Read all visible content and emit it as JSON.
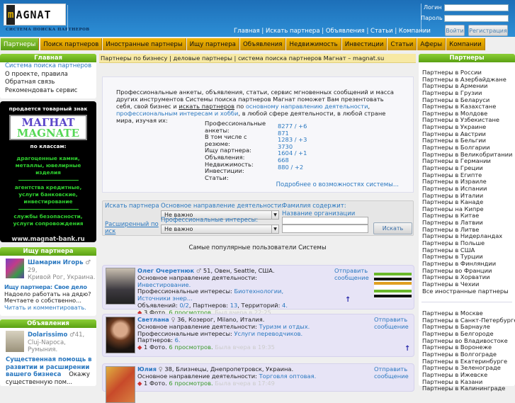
{
  "header": {
    "logo_m": "m",
    "logo_text": "AGNAT",
    "logo_subtitle": "СИСТЕМА ПОИСКА ПАРТНЕРОВ",
    "links": [
      "Главная",
      "Искать партнера",
      "Объявления",
      "Статьи",
      "Компании"
    ],
    "login_label": "Логин",
    "password_label": "Пароль",
    "login_button": "Войти",
    "register_button": "Регистрация"
  },
  "nav": [
    "Партнеры",
    "Поиск партнеров",
    "Иностранные партнеры",
    "Ищу партнера",
    "Объявления",
    "Недвижимость",
    "Инвестиции",
    "Статьи",
    "Аферы",
    "Компании"
  ],
  "left": {
    "main_title": "Главная",
    "main_items": [
      "Система поиска партнеров",
      "О проекте, правила",
      "Обратная связь",
      "Рекомендовать сервис"
    ],
    "banner": {
      "title": "продается товарный знак",
      "tm_line1": "MAГHAT",
      "tm_line2": "MAGNATE",
      "classes": "по классам:",
      "c1": "драгоценные камни, металлы, ювелирные изделия",
      "c2": "агентства кредитные, услуги банковские, инвестирование",
      "c3": "службы безопасности, услуги сопровождения",
      "url": "www.magnat-bank.ru"
    },
    "seek": {
      "title": "Ищу партнера",
      "user": "Шамарин Игорь",
      "age": "29,",
      "city": "Кривой Рог, Украина.",
      "post_title": "Ищу партнера: Свое дело",
      "post_text": "Надоело работать на дядю? Мечтаете о собственно...",
      "read": "Читать и комментировать."
    },
    "ads": {
      "title": "Объявления",
      "user": "Dolarissimo",
      "age": "41,",
      "city": "Cluj-Napoca, Румыния.",
      "post_title": "Существенная помощь в развитии и расширении вашего бизнеса",
      "post_text": "Окажу существенную пом..."
    }
  },
  "center": {
    "breadcrumb": "Партнеры по бизнесу | деловые партнеры | система поиска партнеров Магнат – magnat.su",
    "intro_1": "Профессиональные анкеты, объявления, статьи, сервис мгновенных сообщений и масса других инструментов Системы поиска партнеров Магнат поможет Вам презентовать себя, свой бизнес и ",
    "intro_link1": "искать партнеров",
    "intro_2": " по ",
    "intro_link2": "основному направлению деятельности",
    "intro_3": ", ",
    "intro_link3": "профессиональным интересам и хобби",
    "intro_4": ", в любой сфере деятельности, в любой стране мира, изучая их:",
    "stats": [
      {
        "label": "Профессиональные анкеты:",
        "value": "8277 / +6"
      },
      {
        "label": "В том числе с резюме:",
        "value": "871"
      },
      {
        "label": "Ищу партнера:",
        "value": "1283 / +3"
      },
      {
        "label": "Объявления:",
        "value": "3730"
      },
      {
        "label": "Недвижимость:",
        "value": "1604 / +1"
      },
      {
        "label": "Инвестиции:",
        "value": "668"
      },
      {
        "label": "Статьи:",
        "value": "880 / +2"
      }
    ],
    "more": "Подробнее о возможностях системы...",
    "search": {
      "title": "Искать партнера",
      "advanced": "Расширенный поиск",
      "activity_label": "Основное направление деятельности:",
      "activity_value": "Не важно",
      "interests_label": "Профессиональные интересы:",
      "interests_value": "Не важно",
      "surname_label": "Фамилия содержит:",
      "org_label": "Название организации содержит:",
      "button": "Искать"
    },
    "popular_title": "Самые популярные пользователи Системы",
    "users": [
      {
        "name": "Олег Очеретнюк",
        "info": "51, Овен, Seattle, США.",
        "activity_label": "Основное направление деятельности: ",
        "activity": "Инвестирование.",
        "interests_label": "Профессиональные интересы: ",
        "interests": "Биотехнологии, Источники энер...",
        "counts_a": "Объявлений: ",
        "ads": "0/2",
        "counts_b": ", Партнеров: ",
        "partners": "13",
        "counts_c": ", Территорий: ",
        "territories": "4.",
        "photos": "3 Фото.",
        "views": "6 просмотров.",
        "seen": "Был вчера в 22:25",
        "send": "Отправить сообщение"
      },
      {
        "name": "Светлана",
        "info": "36, Козерог, Milano, Италия.",
        "activity_label": "Основное направление деятельности: ",
        "activity": "Туризм и отдых.",
        "interests_label": "Профессиональные интересы: ",
        "interests": "Услуги переводчиков.",
        "partners_label": "Партнеров: ",
        "partners": "6.",
        "photos": "1 Фото.",
        "views": "6 просмотров.",
        "seen": "Была вчера в 19:35",
        "send": "Отправить сообщение"
      },
      {
        "name": "Юлия",
        "info": "38, Близнецы, Днепропетровск, Украина.",
        "activity_label": "Основное направление деятельности: ",
        "activity": "Торговля оптовая.",
        "photos": "1 Фото.",
        "views": "6 просмотров.",
        "seen": "Была вчера в 17:49",
        "send": "Отправить сообщение"
      }
    ]
  },
  "right": {
    "title": "Партнеры",
    "countries": [
      "Партнеры в России",
      "Партнеры в Азербайджане",
      "Партнеры в Армении",
      "Партнеры в Грузии",
      "Партнеры в Беларуси",
      "Партнеры в Казахстане",
      "Партнеры в Молдове",
      "Партнеры в Узбекистане",
      "Партнеры в Украине",
      "Партнеры в Австрии",
      "Партнеры в Бельгии",
      "Партнеры в Болгарии",
      "Партнеры в Великобритании",
      "Партнеры в Германии",
      "Партнеры в Греции",
      "Партнеры в Египте",
      "Партнеры в Израиле",
      "Партнеры в Испании",
      "Партнеры в Италии",
      "Партнеры в Канаде",
      "Партнеры на Кипре",
      "Партнеры в Китае",
      "Партнеры в Латвии",
      "Партнеры в Литве",
      "Партнеры в Нидерландах",
      "Партнеры в Польше",
      "Партнеры в США",
      "Партнеры в Турции",
      "Партнеры в Финляндии",
      "Партнеры во Франции",
      "Партнеры в Хорватии",
      "Партнеры в Чехии",
      "Все иностранные партнеры"
    ],
    "cities": [
      "Партнеры в Москве",
      "Партнеры в Санкт-Петербурге",
      "Партнеры в Барнауле",
      "Партнеры в Белгороде",
      "Партнеры во Владивостоке",
      "Партнеры в Воронеже",
      "Партнеры в Волгограде",
      "Партнеры в Екатеринбурге",
      "Партнеры в Зеленограде",
      "Партнеры в Ижевске",
      "Партнеры в Казани",
      "Партнеры в Калининграде"
    ]
  }
}
